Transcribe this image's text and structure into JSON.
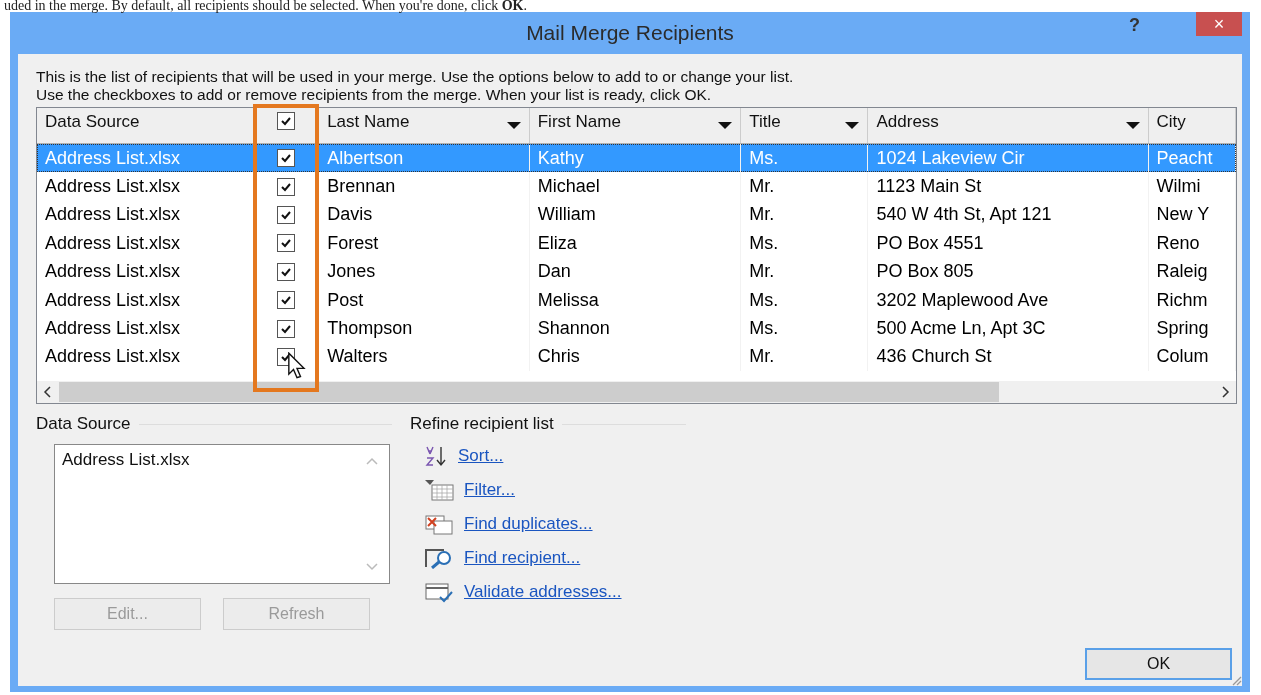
{
  "caption": "uded in the merge. By default, all recipients should be selected. When you're done, click **OK**.",
  "window": {
    "title": "Mail Merge Recipients",
    "help": "?",
    "close": "×"
  },
  "intro": [
    "This is the list of recipients that will be used in your merge.  Use the options below to add to or change your list.",
    "Use the checkboxes to add or remove recipients from the merge.  When your list is ready, click OK."
  ],
  "table": {
    "header_checked": true,
    "columns": [
      {
        "label": "Data Source",
        "dropdown": false
      },
      {
        "label": "Last Name",
        "dropdown": true
      },
      {
        "label": "First Name",
        "dropdown": true
      },
      {
        "label": "Title",
        "dropdown": true
      },
      {
        "label": "Address",
        "dropdown": true
      },
      {
        "label": "City",
        "dropdown": false
      }
    ],
    "rows": [
      {
        "selected": true,
        "checked": true,
        "cells": [
          "Address List.xlsx",
          "Albertson",
          "Kathy",
          "Ms.",
          "1024 Lakeview Cir",
          "Peacht"
        ]
      },
      {
        "selected": false,
        "checked": true,
        "cells": [
          "Address List.xlsx",
          "Brennan",
          "Michael",
          "Mr.",
          "1123 Main St",
          "Wilmi"
        ]
      },
      {
        "selected": false,
        "checked": true,
        "cells": [
          "Address List.xlsx",
          "Davis",
          "William",
          "Mr.",
          "540 W 4th St, Apt 121",
          "New Y"
        ]
      },
      {
        "selected": false,
        "checked": true,
        "cells": [
          "Address List.xlsx",
          "Forest",
          "Eliza",
          "Ms.",
          "PO Box 4551",
          "Reno"
        ]
      },
      {
        "selected": false,
        "checked": true,
        "cells": [
          "Address List.xlsx",
          "Jones",
          "Dan",
          "Mr.",
          "PO Box 805",
          "Raleig"
        ]
      },
      {
        "selected": false,
        "checked": true,
        "cells": [
          "Address List.xlsx",
          "Post",
          "Melissa",
          "Ms.",
          "3202 Maplewood Ave",
          "Richm"
        ]
      },
      {
        "selected": false,
        "checked": true,
        "cells": [
          "Address List.xlsx",
          "Thompson",
          "Shannon",
          "Ms.",
          "500 Acme Ln, Apt 3C",
          "Spring"
        ]
      },
      {
        "selected": false,
        "checked": true,
        "cells": [
          "Address List.xlsx",
          "Walters",
          "Chris",
          "Mr.",
          "436 Church St",
          "Colum"
        ]
      }
    ]
  },
  "data_source": {
    "title": "Data Source",
    "items": [
      "Address List.xlsx"
    ],
    "buttons": [
      {
        "label": "Edit...",
        "disabled": true
      },
      {
        "label": "Refresh",
        "disabled": true
      }
    ]
  },
  "refine": {
    "title": "Refine recipient list",
    "links": [
      {
        "kind": "sort",
        "label": "Sort..."
      },
      {
        "kind": "filter",
        "label": "Filter..."
      },
      {
        "kind": "duplicates",
        "label": "Find duplicates..."
      },
      {
        "kind": "find",
        "label": "Find recipient..."
      },
      {
        "kind": "validate",
        "label": "Validate addresses..."
      }
    ]
  },
  "ok_button": {
    "label": "OK"
  }
}
